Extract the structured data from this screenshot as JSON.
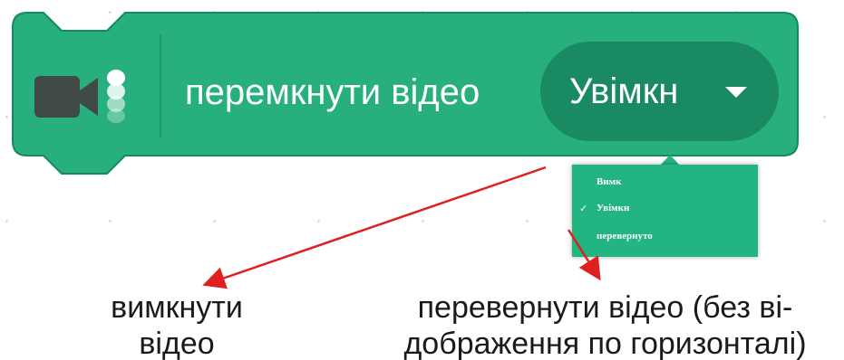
{
  "block": {
    "label": "перемкнути відео",
    "extension_icon": "video-camera-icon",
    "color": "#27b07e",
    "border_color": "#168a5f",
    "dropdown": {
      "selected": "Увімкн",
      "caret_icon": "triangle-down-icon",
      "color": "#1a8a63"
    }
  },
  "menu": {
    "items": [
      {
        "label": "Вимк",
        "checked": false
      },
      {
        "label": "Увімкн",
        "checked": true
      },
      {
        "label": "перевернуто",
        "checked": false
      }
    ],
    "check_mark": "✓",
    "color": "#22b582"
  },
  "annotations": {
    "left": {
      "line1": "вимкнути",
      "line2": "відео"
    },
    "right": {
      "line1": "перевернути відео (без ві-",
      "line2": "дображення по горизонталі)"
    },
    "arrow_color": "#e02020"
  }
}
